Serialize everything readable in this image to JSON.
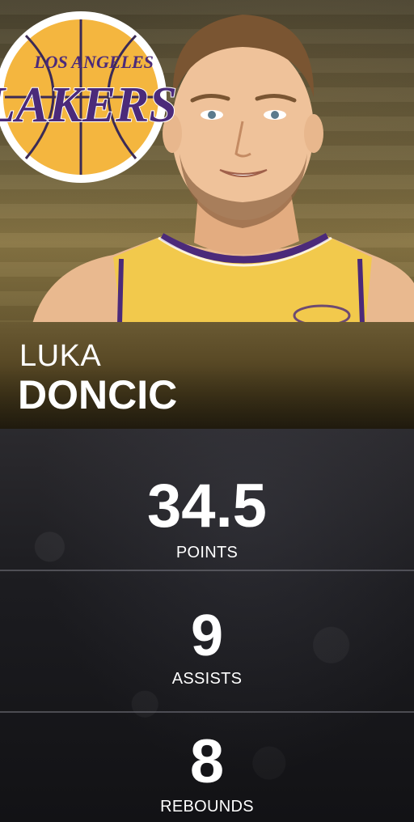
{
  "logo": {
    "text_top": "LOS ANGELES",
    "text_main": "LAKERS"
  },
  "player": {
    "first_name": "LUKA",
    "last_name": "DONCIC"
  },
  "stats": [
    {
      "value": "34.5",
      "label": "POINTS"
    },
    {
      "value": "9",
      "label": "ASSISTS"
    },
    {
      "value": "8",
      "label": "REBOUNDS"
    }
  ],
  "colors": {
    "lakers_gold": "#fdb927",
    "lakers_purple": "#552583",
    "banner_gold": "#6a5a33"
  }
}
